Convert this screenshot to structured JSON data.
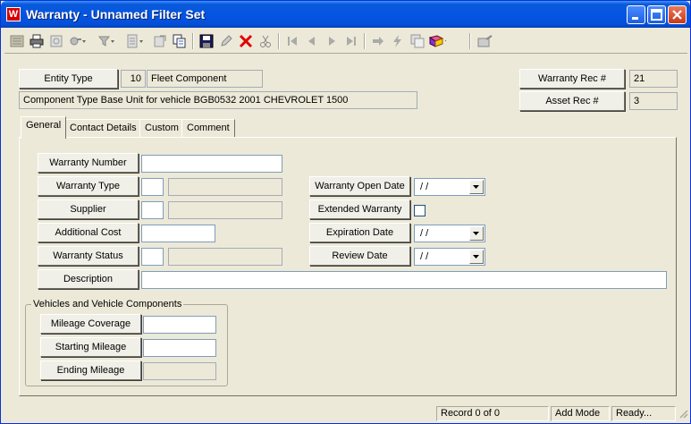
{
  "window": {
    "title": "Warranty - Unnamed Filter Set",
    "app_icon_letter": "W"
  },
  "header": {
    "entity_type_label": "Entity Type",
    "entity_type_code": "10",
    "entity_type_name": "Fleet Component",
    "description": "Component Type Base Unit for vehicle BGB0532 2001 CHEVROLET 1500",
    "warranty_rec_label": "Warranty Rec #",
    "warranty_rec_value": "21",
    "asset_rec_label": "Asset Rec #",
    "asset_rec_value": "3"
  },
  "tabs": [
    {
      "label": "General",
      "active": true
    },
    {
      "label": "Contact Details",
      "active": false
    },
    {
      "label": "Custom",
      "active": false
    },
    {
      "label": "Comment",
      "active": false
    }
  ],
  "general": {
    "warranty_number_label": "Warranty Number",
    "warranty_number_value": "",
    "warranty_type_label": "Warranty Type",
    "supplier_label": "Supplier",
    "additional_cost_label": "Additional Cost",
    "warranty_status_label": "Warranty Status",
    "description_label": "Description",
    "warranty_open_date_label": "Warranty Open Date",
    "warranty_open_date_value": " /  /",
    "extended_warranty_label": "Extended Warranty",
    "expiration_date_label": "Expiration Date",
    "expiration_date_value": " /  /",
    "review_date_label": "Review Date",
    "review_date_value": " /  /"
  },
  "vehicles": {
    "group_label": "Vehicles and Vehicle Components",
    "mileage_coverage_label": "Mileage Coverage",
    "starting_mileage_label": "Starting Mileage",
    "ending_mileage_label": "Ending Mileage"
  },
  "status_bar": {
    "record": "Record 0 of 0",
    "mode": "Add Mode",
    "state": "Ready..."
  },
  "toolbar_icons": [
    "list-icon",
    "print-icon",
    "print-preview-icon",
    "query-icon",
    "filter-icon",
    "report-icon",
    "export-icon",
    "copy-icon",
    "save-icon",
    "edit-icon",
    "delete-icon",
    "cut-icon",
    "first-record-icon",
    "previous-record-icon",
    "next-record-icon",
    "last-record-icon",
    "goto-icon",
    "action-icon",
    "attachments-icon",
    "notes-book-icon",
    "exit-icon"
  ],
  "colors": {
    "titlebar": "#0554e3",
    "window_bg": "#ece9d8",
    "delete_red": "#e00000"
  }
}
